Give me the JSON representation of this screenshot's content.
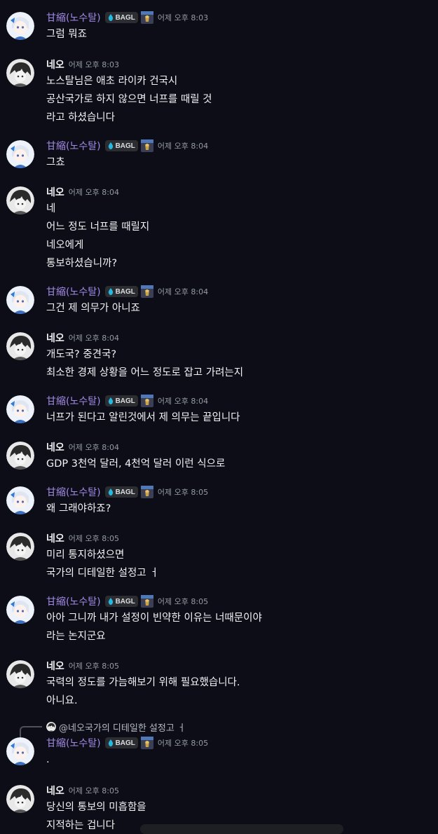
{
  "users": {
    "a": {
      "name": "甘縮(노수탈)",
      "badge": "BAGL"
    },
    "b": {
      "name": "네오"
    }
  },
  "messages": [
    {
      "user": "a",
      "time": "어제 오후 8:03",
      "lines": [
        "그럼 뭐죠"
      ]
    },
    {
      "user": "b",
      "time": "어제 오후 8:03",
      "lines": [
        "노스탈님은 애초 라이카 건국시",
        "공산국가로 하지 않으면 너프를 때릴 것",
        "라고 하셨습니다"
      ]
    },
    {
      "user": "a",
      "time": "어제 오후 8:04",
      "lines": [
        "그쵸"
      ]
    },
    {
      "user": "b",
      "time": "어제 오후 8:04",
      "lines": [
        "네",
        "어느 정도 너프를 때릴지",
        "네오에게",
        "통보하셨습니까?"
      ]
    },
    {
      "user": "a",
      "time": "어제 오후 8:04",
      "lines": [
        "그건 제 의무가 아니죠"
      ]
    },
    {
      "user": "b",
      "time": "어제 오후 8:04",
      "lines": [
        "개도국? 중견국?",
        "최소한 경제 상황을 어느 정도로 잡고 가려는지"
      ]
    },
    {
      "user": "a",
      "time": "어제 오후 8:04",
      "lines": [
        "너프가 된다고 알린것에서 제 의무는 끝입니다"
      ]
    },
    {
      "user": "b",
      "time": "어제 오후 8:04",
      "lines": [
        "GDP 3천억 달러, 4천억 달러 이런 식으로"
      ]
    },
    {
      "user": "a",
      "time": "어제 오후 8:05",
      "lines": [
        "왜 그래야하죠?"
      ]
    },
    {
      "user": "b",
      "time": "어제 오후 8:05",
      "lines": [
        "미리 통지하셨으면",
        "국가의 디테일한 설정고 ㅓ"
      ]
    },
    {
      "user": "a",
      "time": "어제 오후 8:05",
      "lines": [
        "아아 그니까 내가 설정이 빈약한 이유는 너때문이야",
        "라는 논지군요"
      ]
    },
    {
      "user": "b",
      "time": "어제 오후 8:05",
      "lines": [
        "국력의 정도를 가늠해보기 위해 필요했습니다.",
        "아니요."
      ]
    },
    {
      "user": "a",
      "time": "어제 오후 8:05",
      "lines": [
        "."
      ]
    },
    {
      "user": "b",
      "time": "어제 오후 8:05",
      "lines": [
        "당신의 통보의 미흡함을",
        "지적하는 겁니다"
      ]
    }
  ],
  "reply": {
    "mention": "@네오",
    "text": "국가의 디테일한 설정고 ㅓ"
  },
  "colors": {
    "background": "#0d0d17",
    "name_purple": "#a28ae5",
    "badge_drop": "#25b8e0"
  }
}
